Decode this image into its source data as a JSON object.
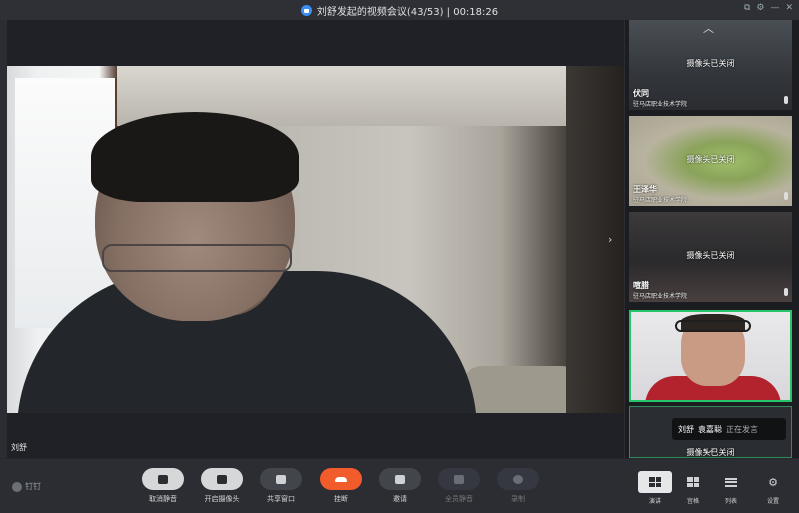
{
  "titlebar": {
    "title": "刘舒发起的视频会议(43/53) | 00:18:26",
    "controls": [
      "⧉",
      "⚙",
      "—",
      "✕"
    ]
  },
  "stage": {
    "speaker_name": "刘舒",
    "next_arrow": "›"
  },
  "sidebar": {
    "up_arrow": "︿",
    "down_arrow": "﹀",
    "tiles": [
      {
        "camera_status": "摄像头已关闭",
        "name": "伏同",
        "org": "驻马店职业技术学院"
      },
      {
        "camera_status": "摄像头已关闭",
        "name": "王泽华",
        "org": "驻马店职业技术学院"
      },
      {
        "camera_status": "摄像头已关闭",
        "name": "喧腊",
        "org": "驻马店职业技术学院"
      },
      {
        "camera_status": "",
        "name": "",
        "org": ""
      },
      {
        "camera_status": "摄像头已关闭",
        "name": "",
        "org": ""
      }
    ]
  },
  "speaking_toast": {
    "name1": "刘舒",
    "name2": "袁嘉聪",
    "status": "正在发言"
  },
  "toolbar": {
    "brand": "钉钉",
    "buttons": [
      {
        "label": "取消静音"
      },
      {
        "label": "开启摄像头"
      },
      {
        "label": "共享窗口"
      },
      {
        "label": "挂断"
      },
      {
        "label": "邀请"
      },
      {
        "label": "全员静音"
      },
      {
        "label": "录制"
      }
    ],
    "view_buttons": [
      {
        "label": "演讲"
      },
      {
        "label": "宫格"
      },
      {
        "label": "列表"
      },
      {
        "label": "设置"
      }
    ]
  },
  "colors": {
    "active_border": "#25c46b",
    "hangup": "#f25b2b",
    "lock": "#3a8ef6"
  }
}
